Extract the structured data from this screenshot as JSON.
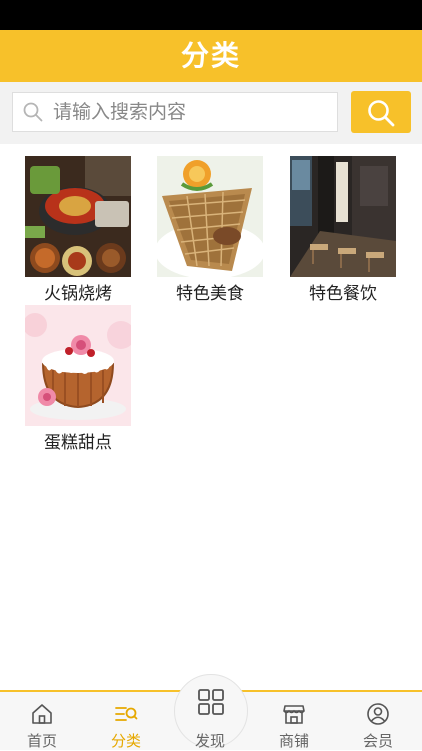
{
  "header": {
    "title": "分类"
  },
  "search": {
    "placeholder": "请输入搜索内容",
    "value": ""
  },
  "categories": [
    {
      "label": "火锅烧烤"
    },
    {
      "label": "特色美食"
    },
    {
      "label": "特色餐饮"
    },
    {
      "label": "蛋糕甜点"
    }
  ],
  "tabbar": {
    "items": [
      {
        "label": "首页"
      },
      {
        "label": "分类"
      },
      {
        "label": "发现"
      },
      {
        "label": "商铺"
      },
      {
        "label": "会员"
      }
    ]
  },
  "colors": {
    "accent": "#f7c12a",
    "active_text": "#e6a800"
  }
}
